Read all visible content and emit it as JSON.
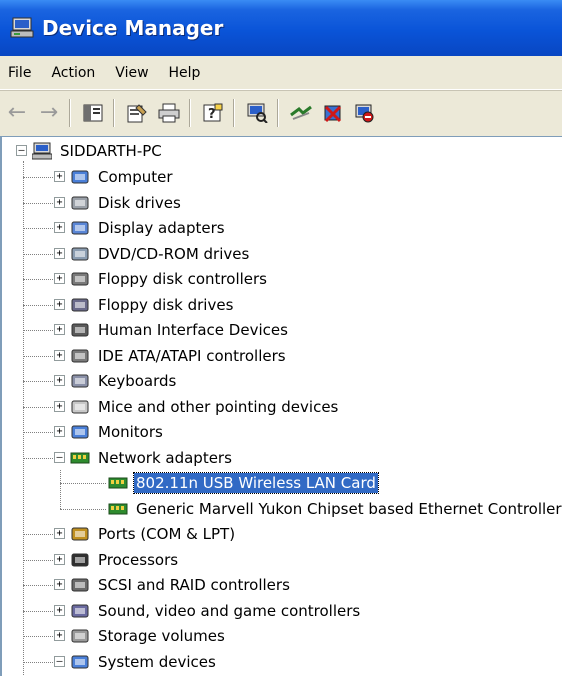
{
  "window": {
    "title": "Device Manager"
  },
  "menu": [
    "File",
    "Action",
    "View",
    "Help"
  ],
  "toolbar": {
    "buttons": [
      "back-arrow-icon",
      "forward-arrow-icon",
      "show-hide-console-tree-icon",
      "properties-icon",
      "print-icon",
      "help-icon",
      "scan-hardware-icon",
      "update-driver-icon",
      "uninstall-icon",
      "disable-device-icon"
    ]
  },
  "tree": {
    "root": "SIDDARTH-PC",
    "categories": [
      {
        "label": "Computer",
        "icon": "computer-icon",
        "expanded": false
      },
      {
        "label": "Disk drives",
        "icon": "disk-drive-icon",
        "expanded": false
      },
      {
        "label": "Display adapters",
        "icon": "display-adapter-icon",
        "expanded": false
      },
      {
        "label": "DVD/CD-ROM drives",
        "icon": "cdrom-icon",
        "expanded": false
      },
      {
        "label": "Floppy disk controllers",
        "icon": "floppy-controller-icon",
        "expanded": false
      },
      {
        "label": "Floppy disk drives",
        "icon": "floppy-drive-icon",
        "expanded": false
      },
      {
        "label": "Human Interface Devices",
        "icon": "hid-icon",
        "expanded": false
      },
      {
        "label": "IDE ATA/ATAPI controllers",
        "icon": "ide-controller-icon",
        "expanded": false
      },
      {
        "label": "Keyboards",
        "icon": "keyboard-icon",
        "expanded": false
      },
      {
        "label": "Mice and other pointing devices",
        "icon": "mouse-icon",
        "expanded": false
      },
      {
        "label": "Monitors",
        "icon": "monitor-icon",
        "expanded": false
      },
      {
        "label": "Network adapters",
        "icon": "network-adapter-icon",
        "expanded": true,
        "children": [
          {
            "label": "802.11n USB Wireless LAN Card",
            "selected": true
          },
          {
            "label": "Generic Marvell Yukon Chipset based Ethernet Controller",
            "selected": false
          }
        ]
      },
      {
        "label": "Ports (COM & LPT)",
        "icon": "port-icon",
        "expanded": false
      },
      {
        "label": "Processors",
        "icon": "processor-icon",
        "expanded": false
      },
      {
        "label": "SCSI and RAID controllers",
        "icon": "scsi-icon",
        "expanded": false
      },
      {
        "label": "Sound, video and game controllers",
        "icon": "sound-icon",
        "expanded": false
      },
      {
        "label": "Storage volumes",
        "icon": "storage-volume-icon",
        "expanded": false
      },
      {
        "label": "System devices",
        "icon": "system-device-icon",
        "expanded": true
      }
    ]
  },
  "colors": {
    "title_bar": "#0a54d8",
    "selection": "#316ac5",
    "chrome": "#ece9d8"
  }
}
